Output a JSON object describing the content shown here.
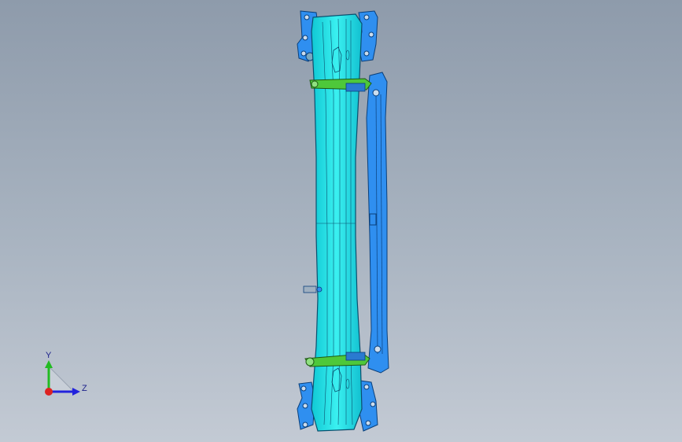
{
  "viewport": {
    "model_name": "bumper-beam-assembly",
    "colors": {
      "background_top": "#8e9bab",
      "background_bottom": "#c3cad4",
      "beam": "#1ee6e6",
      "beam_edge": "#0a4f6e",
      "bracket": "#2f8ff0",
      "clip": "#4ec83a"
    }
  },
  "triad": {
    "y_label": "Y",
    "z_label": "Z",
    "colors": {
      "y": "#22bb22",
      "z": "#2222dd",
      "x": "#dd2222"
    }
  }
}
